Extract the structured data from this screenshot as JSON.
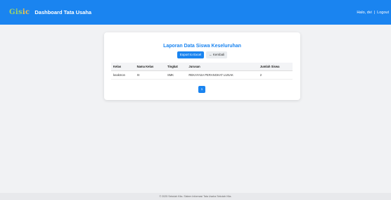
{
  "navbar": {
    "logo_main": "Gis",
    "logo_accent": "ic",
    "title": "Dashboard Tata Usaha",
    "greeting": "Halo, dvi",
    "separator": "|",
    "logout_label": "Logout"
  },
  "report": {
    "title": "Laporan Data Siswa Keseluruhan",
    "export_label": "Export to Excel",
    "back_label": "← Kembali",
    "columns": [
      "Kelas",
      "Nama Kelas",
      "Tingkat",
      "Jurusan",
      "Jumlah Siswa"
    ],
    "rows": [
      [
        "keakmon",
        "XI",
        "SMK",
        "REKAYASA PERANGKAT LUNAK",
        "2"
      ]
    ],
    "pagination": {
      "current_page": "1"
    }
  },
  "footer": {
    "text": "© 2025 Sekolah Kita. Sistem Informasi Tata Usaha Sekolah Kita."
  },
  "colors": {
    "primary": "#1a84f0",
    "background": "#f1f2f4"
  }
}
